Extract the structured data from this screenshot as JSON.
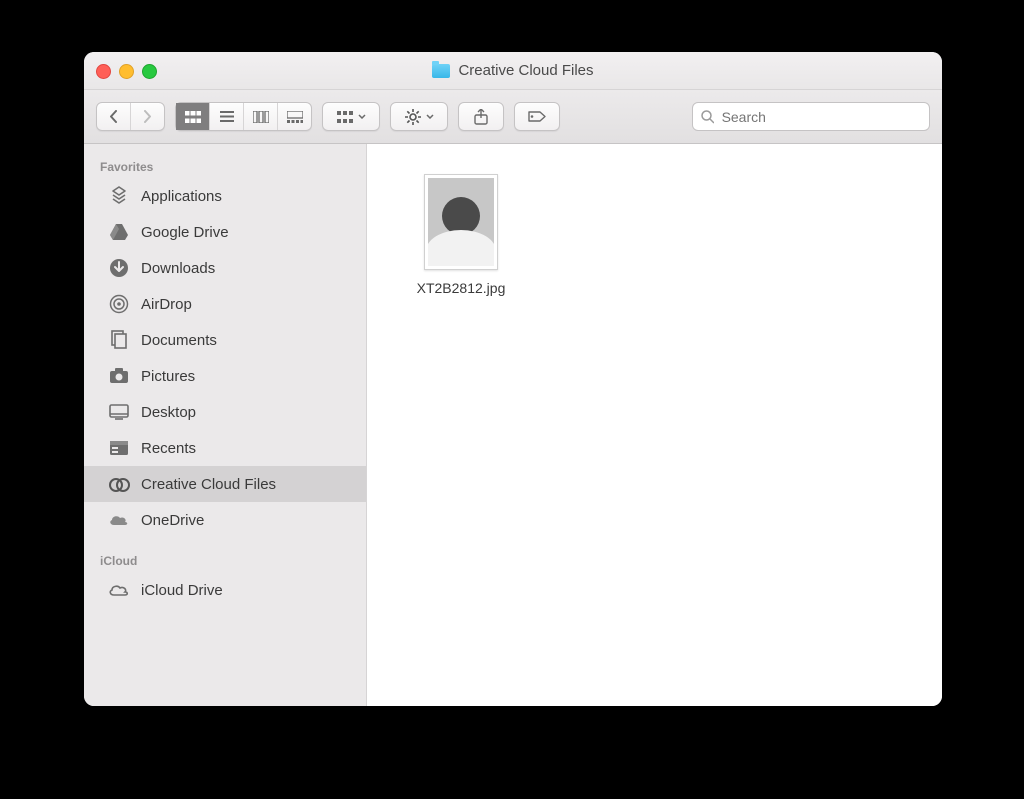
{
  "window": {
    "title": "Creative Cloud Files"
  },
  "search": {
    "placeholder": "Search"
  },
  "sidebar": {
    "sections": [
      {
        "label": "Favorites",
        "items": [
          {
            "label": "Applications",
            "icon": "applications-icon"
          },
          {
            "label": "Google Drive",
            "icon": "gdrive-icon"
          },
          {
            "label": "Downloads",
            "icon": "downloads-icon"
          },
          {
            "label": "AirDrop",
            "icon": "airdrop-icon"
          },
          {
            "label": "Documents",
            "icon": "documents-icon"
          },
          {
            "label": "Pictures",
            "icon": "pictures-icon"
          },
          {
            "label": "Desktop",
            "icon": "desktop-icon"
          },
          {
            "label": "Recents",
            "icon": "recents-icon"
          },
          {
            "label": "Creative Cloud Files",
            "icon": "creative-cloud-icon",
            "selected": true
          },
          {
            "label": "OneDrive",
            "icon": "cloud-icon"
          }
        ]
      },
      {
        "label": "iCloud",
        "items": [
          {
            "label": "iCloud Drive",
            "icon": "cloud-icon"
          }
        ]
      }
    ]
  },
  "files": [
    {
      "name": "XT2B2812.jpg"
    }
  ]
}
